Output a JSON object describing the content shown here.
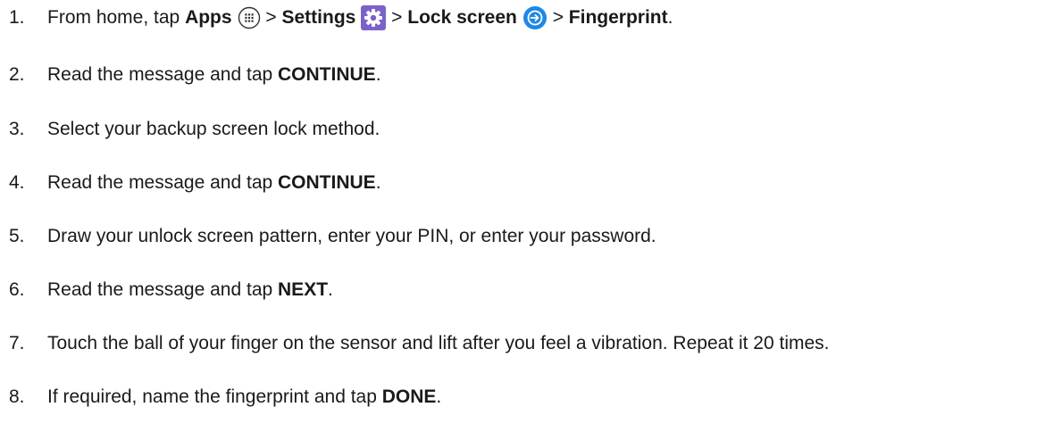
{
  "steps": [
    {
      "num": "1.",
      "segments": {
        "a": "From home, tap ",
        "apps": "Apps",
        "sep1": " > ",
        "settings": "Settings",
        "sep2": " > ",
        "lock_screen": "Lock screen",
        "sep3": " > ",
        "fingerprint": "Fingerprint",
        "end": "."
      },
      "icons": [
        "apps-icon",
        "settings-icon",
        "lock-screen-icon"
      ],
      "icon_colors": {
        "settings": "#7b61c9",
        "lock_screen": "#1e88e5"
      }
    },
    {
      "num": "2.",
      "segments": {
        "a": "Read the message and tap ",
        "bold": "CONTINUE",
        "end": "."
      }
    },
    {
      "num": "3.",
      "segments": {
        "a": "Select your backup screen lock method."
      }
    },
    {
      "num": "4.",
      "segments": {
        "a": "Read the message and tap ",
        "bold": "CONTINUE",
        "end": "."
      }
    },
    {
      "num": "5.",
      "segments": {
        "a": "Draw your unlock screen pattern, enter your PIN, or enter your password."
      }
    },
    {
      "num": "6.",
      "segments": {
        "a": "Read the message and tap ",
        "bold": "NEXT",
        "end": "."
      }
    },
    {
      "num": "7.",
      "segments": {
        "a": "Touch the ball of your finger on the sensor and lift after you feel a vibration. Repeat it 20 times."
      }
    },
    {
      "num": "8.",
      "segments": {
        "a": "If required, name the fingerprint and tap ",
        "bold": "DONE",
        "end": "."
      }
    }
  ]
}
